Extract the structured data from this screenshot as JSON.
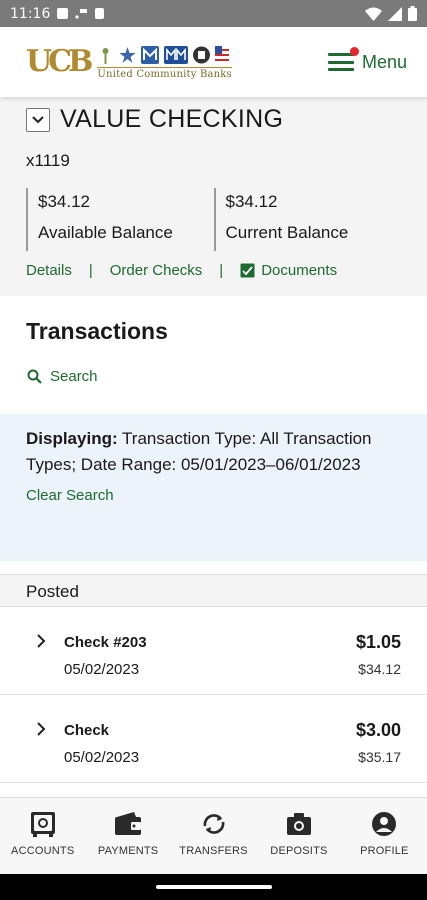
{
  "status_bar": {
    "time": "11:16"
  },
  "header": {
    "logo_mark": "UCB",
    "logo_text": "United Community Banks",
    "menu_label": "Menu"
  },
  "account": {
    "title": "VALUE CHECKING",
    "number": "x1119",
    "available_balance": {
      "amount": "$34.12",
      "label": "Available Balance"
    },
    "current_balance": {
      "amount": "$34.12",
      "label": "Current Balance"
    },
    "links": {
      "details": "Details",
      "order_checks": "Order Checks",
      "documents": "Documents"
    }
  },
  "transactions": {
    "title": "Transactions",
    "search_label": "Search",
    "filter": {
      "prefix": "Displaying:",
      "text": "Transaction Type: All Transaction Types; Date Range: 05/01/2023–06/01/2023",
      "clear_label": "Clear Search"
    },
    "section_label": "Posted",
    "items": [
      {
        "name": "Check #203",
        "date": "05/02/2023",
        "amount": "$1.05",
        "balance": "$34.12"
      },
      {
        "name": "Check",
        "date": "05/02/2023",
        "amount": "$3.00",
        "balance": "$35.17"
      }
    ]
  },
  "bottom_nav": [
    {
      "label": "ACCOUNTS",
      "icon": "accounts-safe-icon"
    },
    {
      "label": "PAYMENTS",
      "icon": "wallet-icon"
    },
    {
      "label": "TRANSFERS",
      "icon": "transfer-arrows-icon"
    },
    {
      "label": "DEPOSITS",
      "icon": "camera-icon"
    },
    {
      "label": "PROFILE",
      "icon": "profile-icon"
    }
  ],
  "colors": {
    "brand_green": "#1d6b30",
    "logo_gold": "#b08a2e",
    "notification": "#e3262b",
    "filter_bg": "#edf3fa"
  }
}
